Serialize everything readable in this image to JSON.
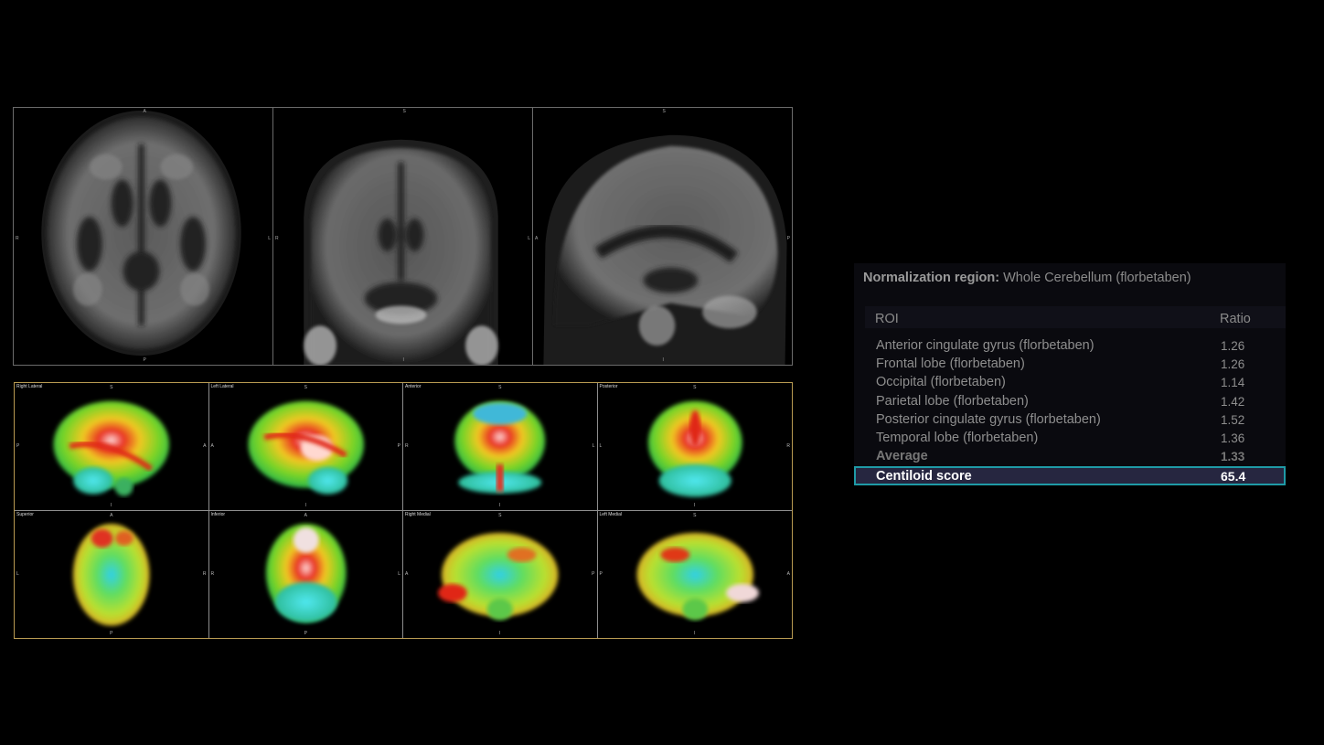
{
  "mri": {
    "views": [
      {
        "name": "axial",
        "top": "A",
        "bottom": "P",
        "left": "R",
        "right": "L"
      },
      {
        "name": "coronal",
        "top": "S",
        "bottom": "I",
        "left": "R",
        "right": "L"
      },
      {
        "name": "sagittal",
        "top": "S",
        "bottom": "I",
        "left": "A",
        "right": "P"
      }
    ]
  },
  "surface_views": [
    {
      "label": "Right Lateral",
      "top": "S",
      "bottom": "I",
      "left": "P",
      "right": "A"
    },
    {
      "label": "Left Lateral",
      "top": "S",
      "bottom": "I",
      "left": "A",
      "right": "P"
    },
    {
      "label": "Anterior",
      "top": "S",
      "bottom": "I",
      "left": "R",
      "right": "L"
    },
    {
      "label": "Posterior",
      "top": "S",
      "bottom": "I",
      "left": "L",
      "right": "R"
    },
    {
      "label": "Superior",
      "top": "A",
      "bottom": "P",
      "left": "L",
      "right": "R"
    },
    {
      "label": "Inferior",
      "top": "A",
      "bottom": "P",
      "left": "R",
      "right": "L"
    },
    {
      "label": "Right Medial",
      "top": "S",
      "bottom": "I",
      "left": "A",
      "right": "P"
    },
    {
      "label": "Left Medial",
      "top": "S",
      "bottom": "I",
      "left": "P",
      "right": "A"
    }
  ],
  "roi_panel": {
    "normalization_label": "Normalization region:",
    "normalization_value": "Whole Cerebellum (florbetaben)",
    "col_roi": "ROI",
    "col_ratio": "Ratio",
    "rows": [
      {
        "name": "Anterior cingulate gyrus (florbetaben)",
        "ratio": "1.26"
      },
      {
        "name": "Frontal lobe (florbetaben)",
        "ratio": "1.26"
      },
      {
        "name": "Occipital (florbetaben)",
        "ratio": "1.14"
      },
      {
        "name": "Parietal lobe (florbetaben)",
        "ratio": "1.42"
      },
      {
        "name": "Posterior cingulate gyrus (florbetaben)",
        "ratio": "1.52"
      },
      {
        "name": "Temporal lobe (florbetaben)",
        "ratio": "1.36"
      }
    ],
    "average_label": "Average",
    "average_value": "1.33",
    "centiloid_label": "Centiloid score",
    "centiloid_value": "65.4",
    "highlight_color": "#1f9aa6"
  }
}
